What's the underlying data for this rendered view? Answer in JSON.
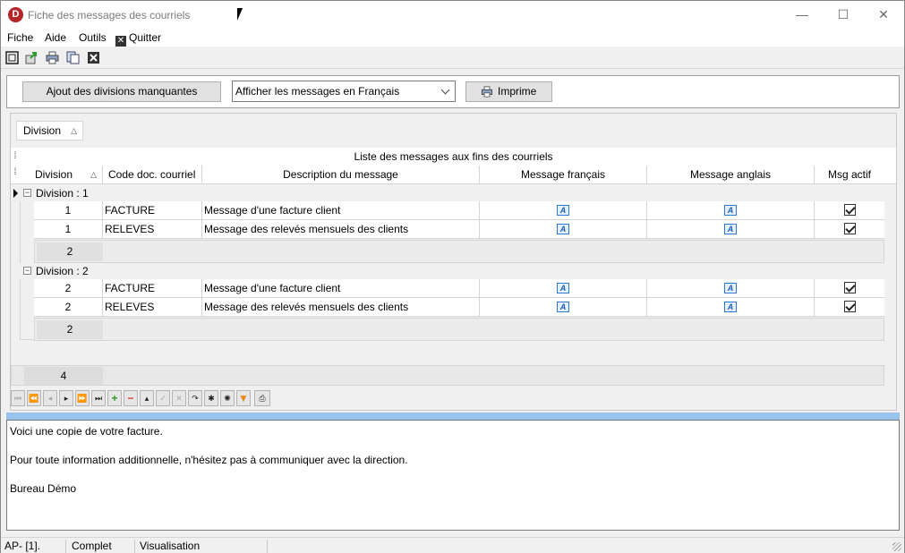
{
  "window": {
    "title": "Fiche des messages des courriels",
    "app_icon_letter": "D",
    "minimize_glyph": "—",
    "maximize_glyph": "☐",
    "close_glyph": "✕"
  },
  "menu": {
    "items": [
      "Fiche",
      "Aide",
      "Outils"
    ],
    "quit_label": "Quitter"
  },
  "toolbar": {
    "icons": [
      "fit-window-icon",
      "export-icon",
      "print-icon",
      "copy-icon",
      "close-icon"
    ]
  },
  "actions": {
    "add_divisions_label": "Ajout des divisions manquantes",
    "language_select_value": "Afficher les messages en Français",
    "print_label": "Imprime"
  },
  "grid": {
    "groupby_chip": "Division",
    "sort_indicator": "△",
    "caption": "Liste des messages aux fins des courriels",
    "columns": [
      "Division",
      "Code doc. courriel",
      "Description du message",
      "Message français",
      "Message anglais",
      "Msg actif"
    ],
    "groups": [
      {
        "label": "Division : 1",
        "expander": "−",
        "rows": [
          {
            "division": "1",
            "code": "FACTURE",
            "description": "Message d'une facture client",
            "active": true
          },
          {
            "division": "1",
            "code": "RELEVES",
            "description": "Message des relevés mensuels des clients",
            "active": true
          }
        ],
        "footer_count": "2"
      },
      {
        "label": "Division : 2",
        "expander": "−",
        "rows": [
          {
            "division": "2",
            "code": "FACTURE",
            "description": "Message d'une facture client",
            "active": true
          },
          {
            "division": "2",
            "code": "RELEVES",
            "description": "Message des relevés mensuels des clients",
            "active": true
          }
        ],
        "footer_count": "2"
      }
    ],
    "total_count": "4",
    "rtf_glyph": "A"
  },
  "navigator": {
    "buttons": [
      {
        "name": "first-record-button",
        "glyph": "⏮",
        "enabled": false
      },
      {
        "name": "prev-page-button",
        "glyph": "⏪",
        "enabled": false
      },
      {
        "name": "prev-record-button",
        "glyph": "◂",
        "enabled": false
      },
      {
        "name": "next-record-button",
        "glyph": "▸",
        "enabled": true
      },
      {
        "name": "next-page-button",
        "glyph": "⏩",
        "enabled": true
      },
      {
        "name": "last-record-button",
        "glyph": "⏭",
        "enabled": true
      },
      {
        "name": "insert-button",
        "glyph": "+",
        "enabled": true
      },
      {
        "name": "delete-button",
        "glyph": "−",
        "enabled": true
      },
      {
        "name": "edit-button",
        "glyph": "▴",
        "enabled": true
      },
      {
        "name": "post-button",
        "glyph": "✓",
        "enabled": false
      },
      {
        "name": "cancel-button",
        "glyph": "✕",
        "enabled": false
      },
      {
        "name": "refresh-button",
        "glyph": "↷",
        "enabled": true
      },
      {
        "name": "bookmark-button",
        "glyph": "✱",
        "enabled": true
      },
      {
        "name": "goto-bookmark-button",
        "glyph": "✺",
        "enabled": true
      },
      {
        "name": "filter-button",
        "glyph": "▼",
        "enabled": true
      },
      {
        "name": "print-grid-button",
        "glyph": "⎙",
        "enabled": true
      }
    ]
  },
  "memo": {
    "lines": [
      "Voici une copie de votre facture.",
      "",
      "Pour toute information additionnelle, n'hésitez pas à communiquer avec la direction.",
      "",
      "Bureau Démo"
    ]
  },
  "status": {
    "panels": [
      "AP- [1].",
      "Complet",
      "Visualisation",
      ""
    ]
  },
  "colors": {
    "accent": "#99c3ec",
    "app_icon": "#b3262a",
    "rtf_icon": "#2f7ad1",
    "add_green": "#2a9d2a",
    "delete_red": "#d23a3a",
    "filter_orange": "#e58a1b"
  }
}
